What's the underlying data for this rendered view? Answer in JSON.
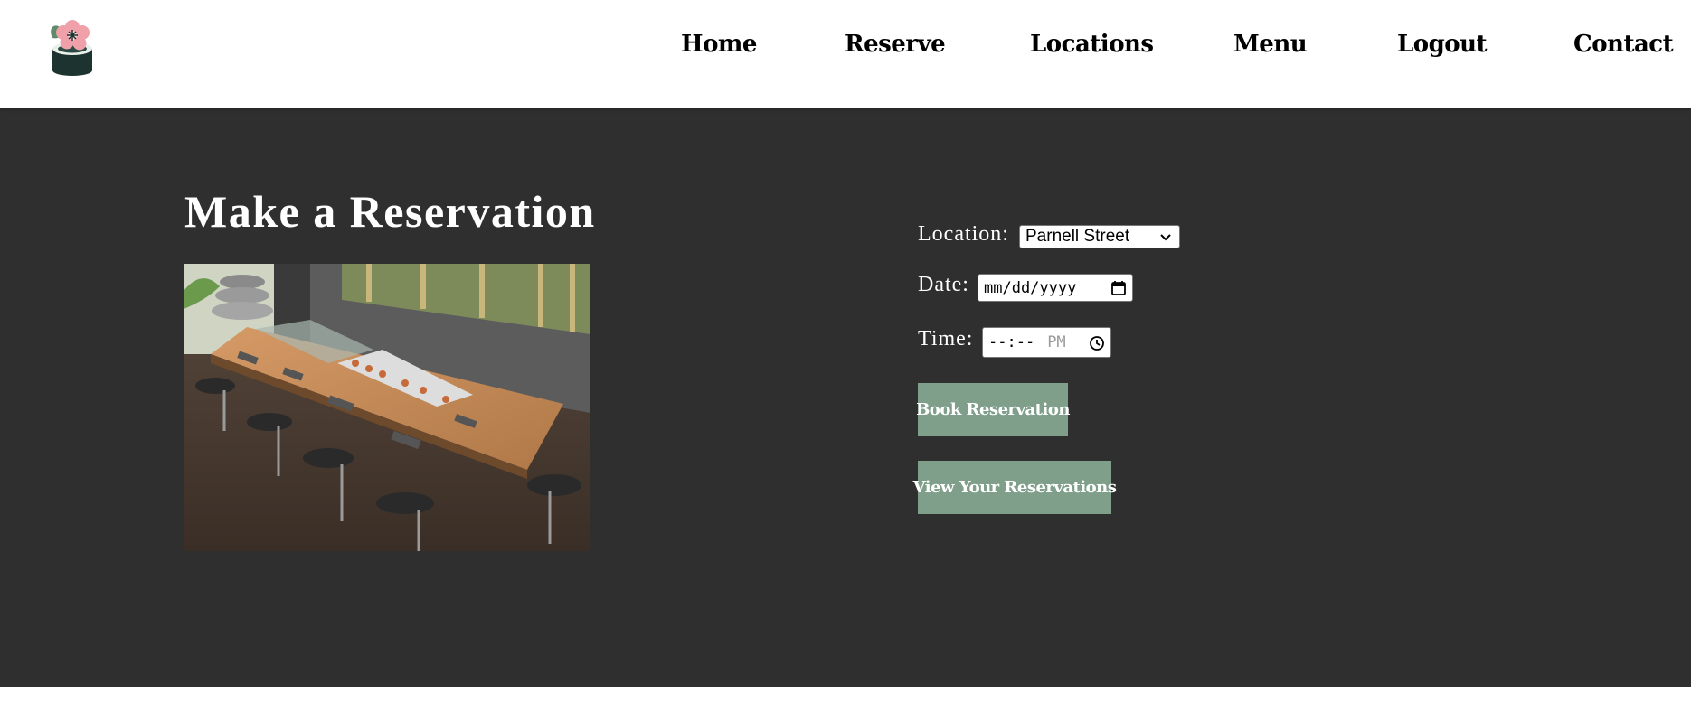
{
  "header": {
    "logo": "sushi-flower-logo",
    "nav": [
      {
        "label": "Home"
      },
      {
        "label": "Reserve"
      },
      {
        "label": "Locations"
      },
      {
        "label": "Menu"
      },
      {
        "label": "Logout"
      },
      {
        "label": "Contact"
      }
    ]
  },
  "main": {
    "title": "Make a Reservation",
    "image": "sushi-bar-counter-photo",
    "form": {
      "location_label": "Location:",
      "location_value": "Parnell Street",
      "date_label": "Date:",
      "date_value": "mm/dd/yyyy",
      "time_label": "Time:",
      "time_value": "--:--",
      "time_period": "PM",
      "book_button": "Book Reservation",
      "view_button": "View Your Reservations"
    }
  },
  "colors": {
    "main_background": "#2f2f2f",
    "button_background": "#7f9f8a",
    "header_background": "#ffffff",
    "text_light": "#ffffff"
  },
  "icons": {
    "select_arrow": "chevron-down-icon",
    "date_picker": "calendar-icon",
    "time_picker": "clock-icon"
  }
}
